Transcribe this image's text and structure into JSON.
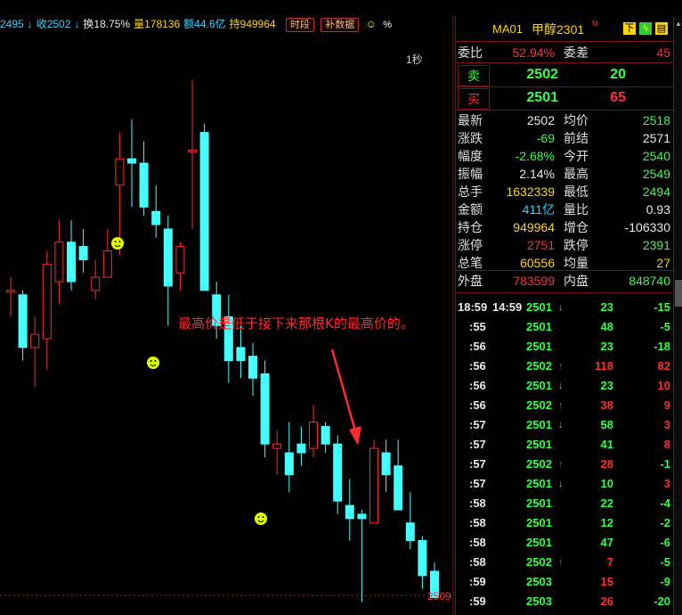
{
  "topbar": {
    "items": [
      {
        "text": "2495",
        "color": "#33d0ff"
      },
      {
        "text": "↓",
        "color": "#33d0ff"
      },
      {
        "text": "收2502",
        "color": "#33d0ff"
      },
      {
        "text": "↓",
        "color": "#33d0ff"
      },
      {
        "text": "换18.75%",
        "color": "#e8e8e8"
      },
      {
        "text": "量178136",
        "color": "#ffd400"
      },
      {
        "text": "额44.6亿",
        "color": "#33d0ff"
      },
      {
        "text": "持949964",
        "color": "#ffd400"
      }
    ],
    "btn_period": "时段",
    "btn_data": "补数据",
    "interval_label": "1秒",
    "price_level": "2509"
  },
  "annotation": "最高价是低于接下来那根K的最高价的。",
  "panel": {
    "code": "MA01",
    "name": "甲醇2301",
    "mark": "M",
    "icon_down": "下",
    "weibi_label": "委比",
    "weibi_value": "52.94%",
    "weicha_label": "委差",
    "weicha_value": "45",
    "sell_label": "卖",
    "sell_price": "2502",
    "sell_vol": "20",
    "buy_label": "买",
    "buy_price": "2501",
    "buy_vol": "65",
    "stats": [
      {
        "l1": "最新",
        "v1": "2502",
        "c1": "white",
        "l2": "均价",
        "v2": "2518",
        "c2": "green"
      },
      {
        "l1": "涨跌",
        "v1": "-69",
        "c1": "green",
        "l2": "前结",
        "v2": "2571",
        "c2": "white"
      },
      {
        "l1": "幅度",
        "v1": "-2.68%",
        "c1": "green",
        "l2": "今开",
        "v2": "2540",
        "c2": "green"
      },
      {
        "l1": "振幅",
        "v1": "2.14%",
        "c1": "white",
        "l2": "最高",
        "v2": "2549",
        "c2": "green"
      },
      {
        "l1": "总手",
        "v1": "1632339",
        "c1": "yellow",
        "l2": "最低",
        "v2": "2494",
        "c2": "green"
      },
      {
        "l1": "金额",
        "v1": "411亿",
        "c1": "cyan",
        "l2": "量比",
        "v2": "0.93",
        "c2": "white"
      },
      {
        "l1": "持仓",
        "v1": "949964",
        "c1": "yellow",
        "l2": "增仓",
        "v2": "-106330",
        "c2": "white"
      },
      {
        "l1": "涨停",
        "v1": "2751",
        "c1": "red",
        "l2": "跌停",
        "v2": "2391",
        "c2": "green"
      },
      {
        "l1": "总笔",
        "v1": "60556",
        "c1": "yellow",
        "l2": "均量",
        "v2": "27",
        "c2": "yellow"
      }
    ],
    "waipan_label": "外盘",
    "waipan_value": "783599",
    "neipan_label": "内盘",
    "neipan_value": "848740",
    "ticks": [
      {
        "time": "18:59",
        "time2": "14:59",
        "price": "2501",
        "dir": "↓",
        "pcolor": "green",
        "vol": "23",
        "vcolor": "green",
        "chg": "-15",
        "ccolor": "green"
      },
      {
        "time": ":55",
        "time2": "",
        "price": "2501",
        "dir": "",
        "pcolor": "green",
        "vol": "48",
        "vcolor": "green",
        "chg": "-5",
        "ccolor": "green"
      },
      {
        "time": ":56",
        "time2": "",
        "price": "2501",
        "dir": "",
        "pcolor": "green",
        "vol": "23",
        "vcolor": "green",
        "chg": "-18",
        "ccolor": "green"
      },
      {
        "time": ":56",
        "time2": "",
        "price": "2502",
        "dir": "↑",
        "pcolor": "green",
        "vol": "118",
        "vcolor": "red",
        "chg": "82",
        "ccolor": "red"
      },
      {
        "time": ":56",
        "time2": "",
        "price": "2501",
        "dir": "↓",
        "pcolor": "green",
        "vol": "23",
        "vcolor": "green",
        "chg": "10",
        "ccolor": "red"
      },
      {
        "time": ":56",
        "time2": "",
        "price": "2502",
        "dir": "↑",
        "pcolor": "green",
        "vol": "38",
        "vcolor": "red",
        "chg": "9",
        "ccolor": "red"
      },
      {
        "time": ":57",
        "time2": "",
        "price": "2501",
        "dir": "↓",
        "pcolor": "green",
        "vol": "58",
        "vcolor": "green",
        "chg": "3",
        "ccolor": "red"
      },
      {
        "time": ":57",
        "time2": "",
        "price": "2501",
        "dir": "",
        "pcolor": "green",
        "vol": "41",
        "vcolor": "green",
        "chg": "8",
        "ccolor": "red"
      },
      {
        "time": ":57",
        "time2": "",
        "price": "2502",
        "dir": "↑",
        "pcolor": "green",
        "vol": "28",
        "vcolor": "red",
        "chg": "-1",
        "ccolor": "green"
      },
      {
        "time": ":57",
        "time2": "",
        "price": "2501",
        "dir": "↓",
        "pcolor": "green",
        "vol": "10",
        "vcolor": "green",
        "chg": "3",
        "ccolor": "red"
      },
      {
        "time": ":58",
        "time2": "",
        "price": "2501",
        "dir": "",
        "pcolor": "green",
        "vol": "22",
        "vcolor": "green",
        "chg": "-4",
        "ccolor": "green"
      },
      {
        "time": ":58",
        "time2": "",
        "price": "2501",
        "dir": "",
        "pcolor": "green",
        "vol": "12",
        "vcolor": "green",
        "chg": "-2",
        "ccolor": "green"
      },
      {
        "time": ":58",
        "time2": "",
        "price": "2501",
        "dir": "",
        "pcolor": "green",
        "vol": "47",
        "vcolor": "green",
        "chg": "-6",
        "ccolor": "green"
      },
      {
        "time": ":58",
        "time2": "",
        "price": "2502",
        "dir": "↑",
        "pcolor": "green",
        "vol": "7",
        "vcolor": "red",
        "chg": "-5",
        "ccolor": "green"
      },
      {
        "time": ":59",
        "time2": "",
        "price": "2503",
        "dir": "",
        "pcolor": "green",
        "vol": "15",
        "vcolor": "red",
        "chg": "-9",
        "ccolor": "green"
      },
      {
        "time": ":59",
        "time2": "",
        "price": "2503",
        "dir": "",
        "pcolor": "green",
        "vol": "26",
        "vcolor": "red",
        "chg": "-20",
        "ccolor": "green"
      }
    ]
  },
  "colors": {
    "up": "#ff2a2a",
    "down": "#44ffff",
    "panel_line": "#7a1010",
    "face": "#e0ff00"
  },
  "chart_data": {
    "type": "candlestick",
    "price_marker": 2509,
    "candles": [
      {
        "o": 2546,
        "h": 2549,
        "l": 2540,
        "c": 2546,
        "dir": "up"
      },
      {
        "o": 2545,
        "h": 2546,
        "l": 2530,
        "c": 2533,
        "dir": "down"
      },
      {
        "o": 2533,
        "h": 2540,
        "l": 2524,
        "c": 2536,
        "dir": "up"
      },
      {
        "o": 2535,
        "h": 2555,
        "l": 2528,
        "c": 2552,
        "dir": "up"
      },
      {
        "o": 2557,
        "h": 2562,
        "l": 2543,
        "c": 2548,
        "dir": "up"
      },
      {
        "o": 2557,
        "h": 2562,
        "l": 2546,
        "c": 2548,
        "dir": "down"
      },
      {
        "o": 2556,
        "h": 2560,
        "l": 2550,
        "c": 2553,
        "dir": "down"
      },
      {
        "o": 2549,
        "h": 2553,
        "l": 2544,
        "c": 2546,
        "dir": "up"
      },
      {
        "o": 2555,
        "h": 2560,
        "l": 2549,
        "c": 2549,
        "dir": "up"
      },
      {
        "o": 2570,
        "h": 2582,
        "l": 2554,
        "c": 2576,
        "dir": "up"
      },
      {
        "o": 2575,
        "h": 2585,
        "l": 2565,
        "c": 2576,
        "dir": "down"
      },
      {
        "o": 2575,
        "h": 2580,
        "l": 2563,
        "c": 2565,
        "dir": "down"
      },
      {
        "o": 2564,
        "h": 2570,
        "l": 2558,
        "c": 2561,
        "dir": "down"
      },
      {
        "o": 2560,
        "h": 2563,
        "l": 2538,
        "c": 2547,
        "dir": "down"
      },
      {
        "o": 2550,
        "h": 2557,
        "l": 2546,
        "c": 2556,
        "dir": "up"
      },
      {
        "o": 2578,
        "h": 2594,
        "l": 2560,
        "c": 2578,
        "dir": "up"
      },
      {
        "o": 2582,
        "h": 2584,
        "l": 2550,
        "c": 2546,
        "dir": "down"
      },
      {
        "o": 2545,
        "h": 2548,
        "l": 2535,
        "c": 2538,
        "dir": "down"
      },
      {
        "o": 2540,
        "h": 2545,
        "l": 2525,
        "c": 2530,
        "dir": "down"
      },
      {
        "o": 2533,
        "h": 2538,
        "l": 2526,
        "c": 2530,
        "dir": "down"
      },
      {
        "o": 2531,
        "h": 2534,
        "l": 2522,
        "c": 2526,
        "dir": "down"
      },
      {
        "o": 2527,
        "h": 2530,
        "l": 2508,
        "c": 2511,
        "dir": "down"
      },
      {
        "o": 2510,
        "h": 2514,
        "l": 2504,
        "c": 2511,
        "dir": "up"
      },
      {
        "o": 2509,
        "h": 2516,
        "l": 2500,
        "c": 2504,
        "dir": "down"
      },
      {
        "o": 2511,
        "h": 2515,
        "l": 2506,
        "c": 2509,
        "dir": "down"
      },
      {
        "o": 2510,
        "h": 2520,
        "l": 2508,
        "c": 2516,
        "dir": "up"
      },
      {
        "o": 2515,
        "h": 2516,
        "l": 2509,
        "c": 2511,
        "dir": "down"
      },
      {
        "o": 2511,
        "h": 2513,
        "l": 2495,
        "c": 2498,
        "dir": "down"
      },
      {
        "o": 2497,
        "h": 2503,
        "l": 2489,
        "c": 2494,
        "dir": "down"
      },
      {
        "o": 2495,
        "h": 2496,
        "l": 2475,
        "c": 2494,
        "dir": "down"
      },
      {
        "o": 2510,
        "h": 2512,
        "l": 2494,
        "c": 2493,
        "dir": "up"
      },
      {
        "o": 2509,
        "h": 2512,
        "l": 2500,
        "c": 2504,
        "dir": "down"
      },
      {
        "o": 2506,
        "h": 2512,
        "l": 2496,
        "c": 2496,
        "dir": "down"
      },
      {
        "o": 2493,
        "h": 2500,
        "l": 2487,
        "c": 2489,
        "dir": "down"
      },
      {
        "o": 2489,
        "h": 2490,
        "l": 2478,
        "c": 2481,
        "dir": "down"
      },
      {
        "o": 2482,
        "h": 2484,
        "l": 2476,
        "c": 2476,
        "dir": "down"
      }
    ]
  }
}
